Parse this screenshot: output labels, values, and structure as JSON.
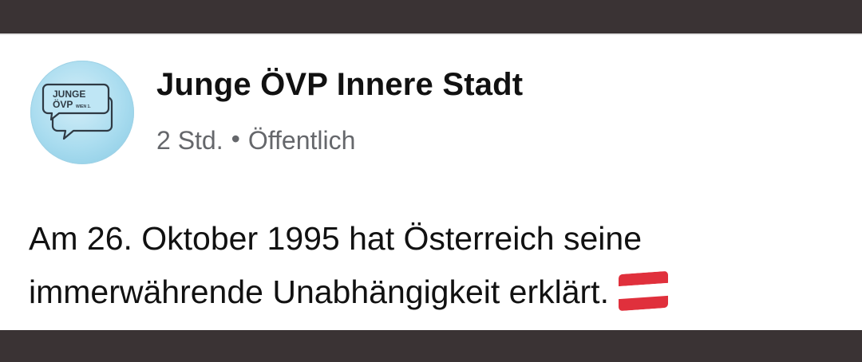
{
  "post": {
    "page_name": "Junge ÖVP Innere Stadt",
    "time": "2 Std.",
    "separator": "•",
    "audience": "Öffentlich",
    "text_line_1": "Am 26. Oktober 1995 hat Österreich seine",
    "text_line_2": "immerwährende Unabhängigkeit erklärt."
  },
  "avatar": {
    "logo_text_1": "JUNGE",
    "logo_text_2": "ÖVP",
    "logo_text_3": "WIEN 1.",
    "icon": "speech-bubble-logo"
  },
  "emoji": {
    "icon": "austria-flag-icon",
    "colors": {
      "red": "#e0303c",
      "white": "#ffffff"
    }
  },
  "colors": {
    "frame": "#3a3334",
    "card_bg": "#ffffff",
    "name_text": "#111111",
    "meta_text": "#65676b",
    "avatar_blue": "#a9dcef"
  }
}
